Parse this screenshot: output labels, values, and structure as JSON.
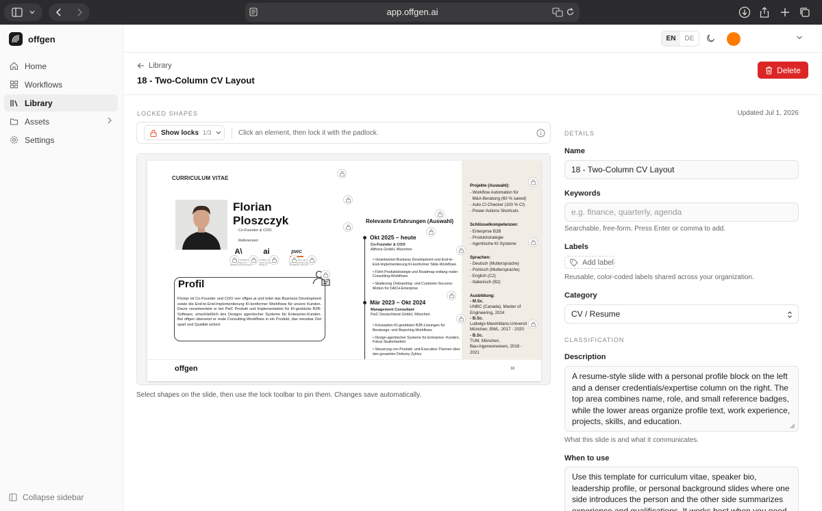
{
  "browser": {
    "url": "app.offgen.ai"
  },
  "sidebar": {
    "brand": "offgen",
    "items": [
      {
        "label": "Home",
        "icon": "home-icon"
      },
      {
        "label": "Workflows",
        "icon": "grid-icon"
      },
      {
        "label": "Library",
        "icon": "library-icon",
        "active": true
      },
      {
        "label": "Assets",
        "icon": "folder-icon"
      },
      {
        "label": "Settings",
        "icon": "gear-icon"
      }
    ],
    "collapse_label": "Collapse sidebar"
  },
  "topbar": {
    "lang_en": "EN",
    "lang_de": "DE",
    "active_lang": "EN",
    "avatar_color": "#ff7a00"
  },
  "header": {
    "back_label": "Library",
    "title": "18 - Two-Column CV Layout",
    "delete_label": "Delete"
  },
  "locked": {
    "section_label": "LOCKED SHAPES",
    "updated": "Updated Jul 1, 2026",
    "show_locks_label": "Show locks",
    "lock_count": "1/3",
    "hint": "Click an element, then lock it with the padlock.",
    "footer_note": "Select shapes on the slide, then use the lock toolbar to pin them. Changes save automatically."
  },
  "slide": {
    "cv_title": "CURRICULUM VITAE",
    "first_name": "Florian",
    "last_name": "Ploszczyk",
    "role": "Co-Founder & COO",
    "refs_label": "Referenzen:",
    "ref_logos": [
      {
        "mark": "A\\",
        "caption": "Anthropic (Artifikat für fortgeschrittene KI-basierte Anwendungen)"
      },
      {
        "mark": "ai",
        "caption": "AI Nation Gründer mit Fokus auf Enterprise-Ready KI"
      },
      {
        "mark": "pwc",
        "caption": "PwC Produkt Lead für die Implementierung von Agentic Systems"
      }
    ],
    "profil_title": "Profil",
    "profil_text": "Florian ist Co-Founder und COO von offgen.ai und leitet das Business Development sowie die End-to-End-Implementierung KI-konformer Workflows für unsere Kunden. Davor verantwortete er bei PwC Produkt und Implementation für KI-gestützte B2B-Software, einschließlich des Designs agentischer Systeme für Enterprise-Kunden. Bei offgen übersetzt er reale Consulting-Workflows in ein Produkt, das messbar Zeit spart und Qualität sichert.",
    "exp_title": "Relevante Erfahrungen (Auswahl)",
    "experiences": [
      {
        "period": "Okt 2025 – heute",
        "role": "Co-Founder & COO",
        "company": "Althera GmbH, München",
        "bullets": [
          "Verantwortet Business Development und End-to-End-Implementierung KI-konformer Slide-Workflows",
          "Führt Produktstrategie und Roadmap entlang realer Consulting-Workflows",
          "Skalierung Onboarding- und Customer-Success-Motion für DACH-Enterprise"
        ]
      },
      {
        "period": "Mär 2023 – Okt 2024",
        "role": "Management Consultant",
        "company": "PwC Deutschland GmbH, München",
        "bullets": [
          "Konzeption KI-gestützter B2B-Lösungen für Beratungs- und Reporting-Workflows",
          "Design agentischer Systeme für Enterprise -Kunden, Fokus Skalierbarkeit",
          "Steuerung von Produkt- und Execution-Themen über den gesamten Delivery-Zyklus"
        ]
      }
    ],
    "right": {
      "projects_title": "Projekte (Auswahl):",
      "projects": [
        "Workflow Automation für",
        "M&A-Beratung (60 % saved)",
        "Auto CI Checker (100 % CI)",
        "Power Actions Shortcuts"
      ],
      "skills_title": "Schlüsselkompetenzen:",
      "skills": [
        "Enterprise B2B",
        "Produktstrategie",
        "Agentische KI-Systeme"
      ],
      "languages_title": "Sprachen:",
      "languages": [
        "Deutsch (Muttersprache)",
        "Polnisch (Muttersprache)",
        "English (C2)",
        "Italienisch (B2)"
      ],
      "education_title": "Ausbildung:",
      "education": [
        {
          "degree": "M.Sc.",
          "lines": [
            "UNBC (Canada), Master of",
            "Engineering, 2024"
          ]
        },
        {
          "degree": "B.Sc.",
          "lines": [
            "Ludwigs-Maximilians-Universit",
            "München, BWL, 2017 - 2020"
          ]
        },
        {
          "degree": "B.Sc.",
          "lines": [
            "TUM, München,",
            "Bau-ingeneurwesen, 2018 -",
            "2021"
          ]
        }
      ]
    },
    "footer_brand": "offgen",
    "page_number": "18"
  },
  "details": {
    "section_label": "DETAILS",
    "name_label": "Name",
    "name_value": "18 - Two-Column CV Layout",
    "keywords_label": "Keywords",
    "keywords_placeholder": "e.g. finance, quarterly, agenda",
    "keywords_help": "Searchable, free-form. Press Enter or comma to add.",
    "labels_label": "Labels",
    "add_label": "Add label",
    "labels_help": "Reusable, color-coded labels shared across your organization.",
    "category_label": "Category",
    "category_value": "CV / Resume",
    "classification_label": "CLASSIFICATION",
    "description_label": "Description",
    "description_value": "A resume-style slide with a personal profile block on the left and a denser credentials/expertise column on the right. The top area combines name, role, and small reference badges, while the lower areas organize profile text, work experience, projects, skills, and education.",
    "description_help": "What this slide is and what it communicates.",
    "when_label": "When to use",
    "when_value": "Use this template for curriculum vitae, speaker bio, leadership profile, or personal background slides where one side introduces the person and the other side summarizes experience and qualifications. It works best when you need a"
  },
  "colors": {
    "accent": "#dc2626",
    "slide_right_bg": "#f2ede4"
  }
}
